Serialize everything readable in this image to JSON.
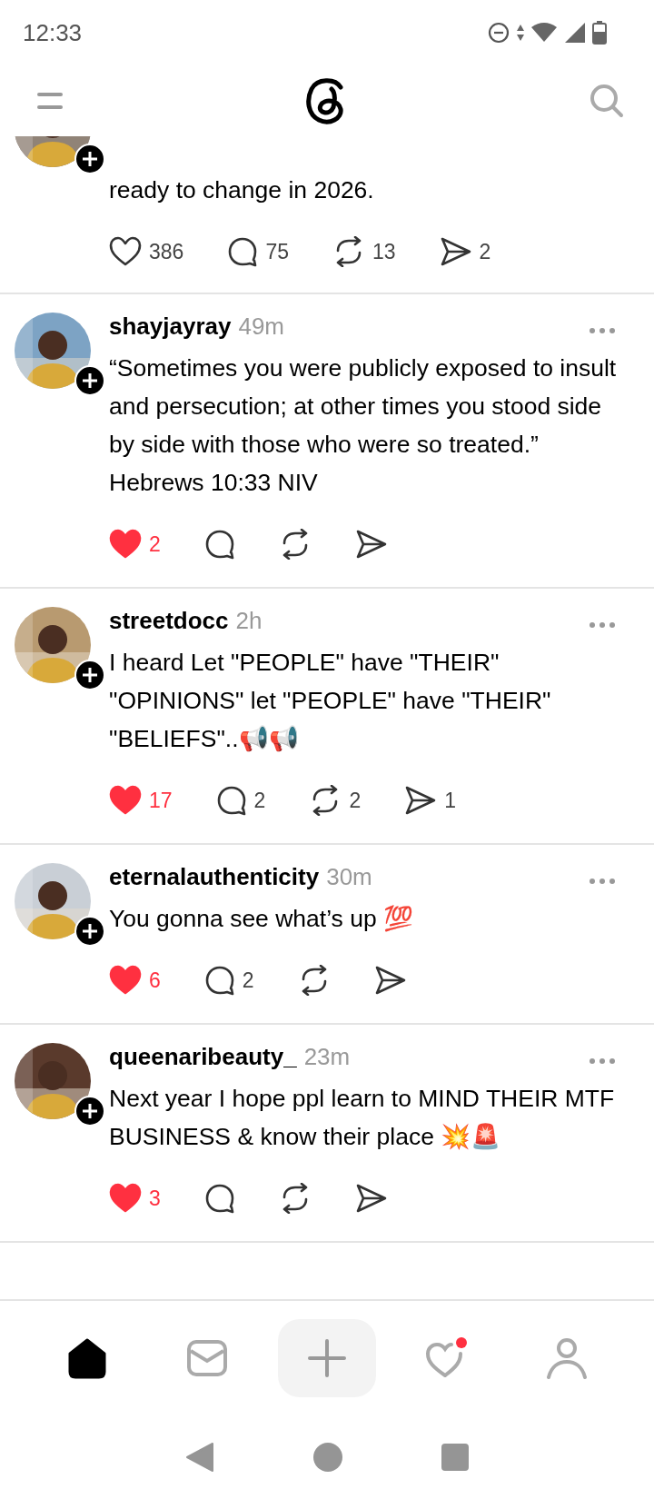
{
  "status_bar": {
    "time": "12:33"
  },
  "posts": [
    {
      "body": [
        "ready to change in 2026."
      ],
      "actions": [
        {
          "kind": "like",
          "count": "386",
          "liked": false
        },
        {
          "kind": "comment",
          "count": "75"
        },
        {
          "kind": "repost",
          "count": "13"
        },
        {
          "kind": "share",
          "count": "2"
        }
      ]
    },
    {
      "username": "shayjayray",
      "time": "49m",
      "body": [
        "“Sometimes you were publicly exposed to insult and persecution; at other times you stood side by side with those who were so treated.”",
        "Hebrews 10:33 NIV"
      ],
      "actions": [
        {
          "kind": "like",
          "count": "2",
          "liked": true
        },
        {
          "kind": "comment"
        },
        {
          "kind": "repost"
        },
        {
          "kind": "share"
        }
      ]
    },
    {
      "username": "streetdocc",
      "time": "2h",
      "body": [
        "I heard Let \"PEOPLE\" have \"THEIR\" \"OPINIONS\" let \"PEOPLE\" have \"THEIR\" \"BELIEFS\"..📢📢"
      ],
      "actions": [
        {
          "kind": "like",
          "count": "17",
          "liked": true
        },
        {
          "kind": "comment",
          "count": "2"
        },
        {
          "kind": "repost",
          "count": "2"
        },
        {
          "kind": "share",
          "count": "1"
        }
      ]
    },
    {
      "username": "eternalauthenticity",
      "time": "30m",
      "body": [
        "You gonna see what’s up 💯"
      ],
      "actions": [
        {
          "kind": "like",
          "count": "6",
          "liked": true
        },
        {
          "kind": "comment",
          "count": "2"
        },
        {
          "kind": "repost"
        },
        {
          "kind": "share"
        }
      ]
    },
    {
      "username": "queenaribeauty_",
      "time": "23m",
      "body": [
        "Next year I hope ppl learn to MIND THEIR MTF BUSINESS & know their place 💥🚨"
      ],
      "actions": [
        {
          "kind": "like",
          "count": "3",
          "liked": true
        },
        {
          "kind": "comment"
        },
        {
          "kind": "repost"
        },
        {
          "kind": "share"
        }
      ]
    }
  ],
  "bottom_nav": [
    {
      "kind": "home",
      "selected": true,
      "dot": false
    },
    {
      "kind": "messages",
      "selected": false,
      "dot": false
    },
    {
      "kind": "create",
      "selected": false,
      "dot": false
    },
    {
      "kind": "activity",
      "selected": false,
      "dot": true
    },
    {
      "kind": "profile",
      "selected": false,
      "dot": false
    }
  ]
}
